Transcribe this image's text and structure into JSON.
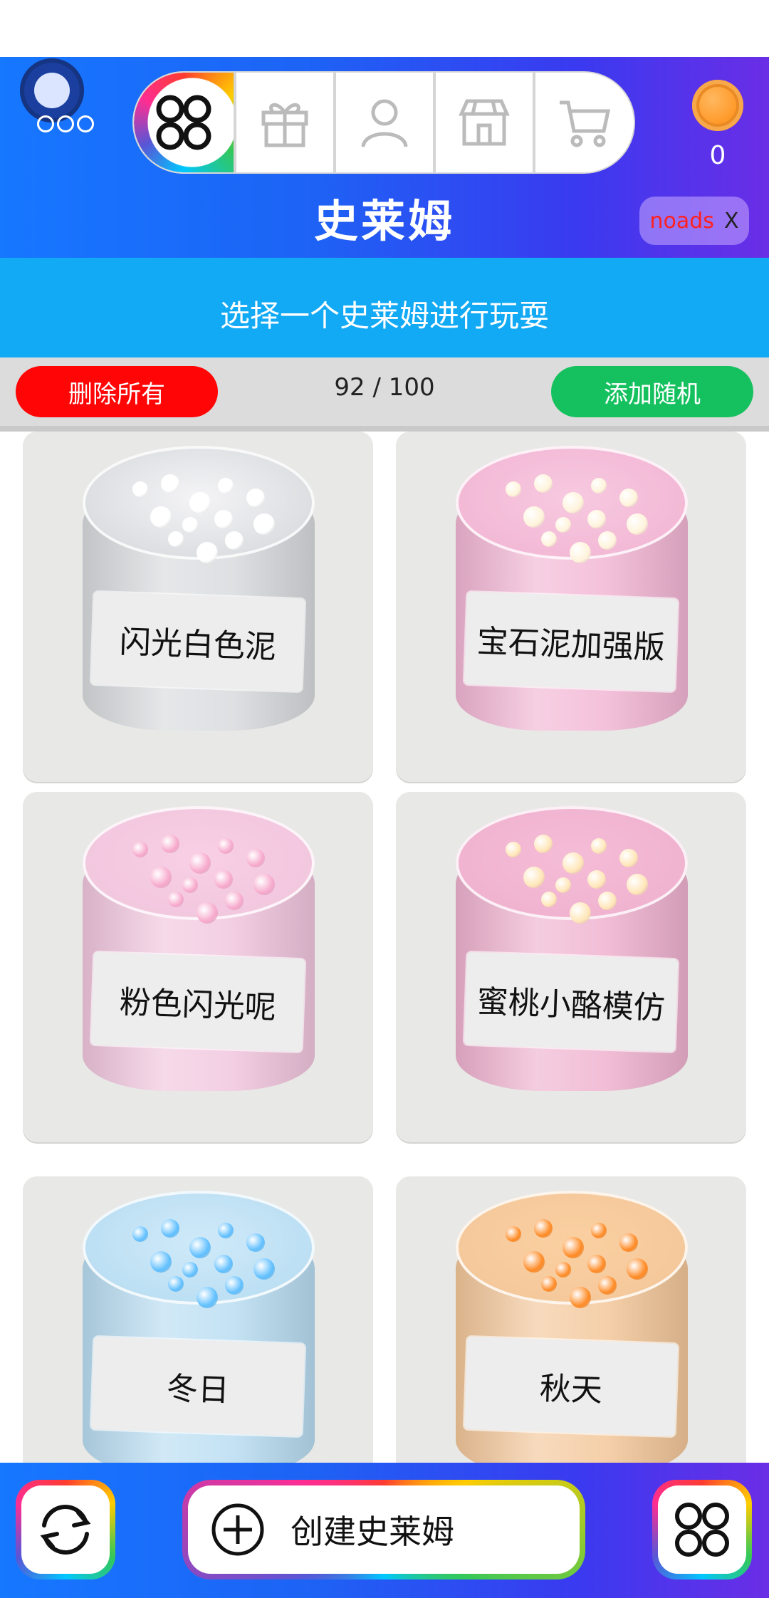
{
  "header": {
    "title": "史莱姆",
    "coins": "0",
    "noads_label": "noads",
    "noads_close": "X",
    "tabs": [
      {
        "icon": "slime-grid-icon",
        "active": true
      },
      {
        "icon": "gift-icon",
        "active": false
      },
      {
        "icon": "profile-icon",
        "active": false
      },
      {
        "icon": "shop-icon",
        "active": false
      },
      {
        "icon": "cart-icon",
        "active": false
      }
    ]
  },
  "subtitle": "选择一个史莱姆进行玩耍",
  "actions": {
    "delete_all": "删除所有",
    "count": "92 / 100",
    "add_random": "添加随机"
  },
  "slimes": [
    {
      "name": "闪光白色泥",
      "color": "#d8dadd",
      "fill": "#f4f4f6",
      "beads": "#ffffff"
    },
    {
      "name": "宝石泥加强版",
      "color": "#f2b6d4",
      "fill": "#f7c9e0",
      "beads": "#fff3da"
    },
    {
      "name": "粉色闪光呢",
      "color": "#f1c6de",
      "fill": "#f8cfe4",
      "beads": "#f7a9cc"
    },
    {
      "name": "蜜桃小酪模仿",
      "color": "#efb2cf",
      "fill": "#f5bcd7",
      "beads": "#ffe6b8"
    },
    {
      "name": "冬日",
      "color": "#b9ddf2",
      "fill": "#cfeaf9",
      "beads": "#5fbfff"
    },
    {
      "name": "秋天",
      "color": "#f3c79a",
      "fill": "#fbd0a1",
      "beads": "#ff8a24"
    }
  ],
  "bottom": {
    "create_label": "创建史莱姆"
  },
  "colors": {
    "header_gradient_start": "#1677ff",
    "header_gradient_end": "#6a2ee6",
    "subtitle_bg": "#12a9f5",
    "delete_bg": "#ff0505",
    "add_bg": "#15c15e"
  }
}
